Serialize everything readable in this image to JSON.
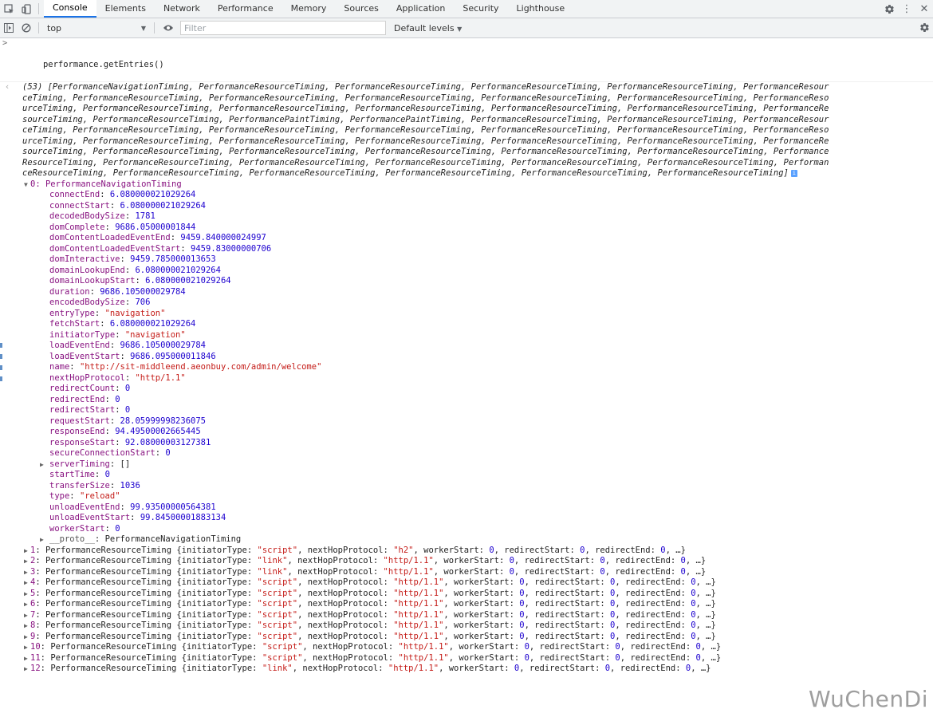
{
  "tabs": {
    "items": [
      "Console",
      "Elements",
      "Network",
      "Performance",
      "Memory",
      "Sources",
      "Application",
      "Security",
      "Lighthouse"
    ],
    "active": "Console"
  },
  "toolbar": {
    "context": "top",
    "filter_placeholder": "Filter",
    "levels": "Default levels"
  },
  "console": {
    "command": "performance.getEntries()",
    "array_lines": [
      "(53) [PerformanceNavigationTiming, PerformanceResourceTiming, PerformanceResourceTiming, PerformanceResourceTiming, PerformanceResourceTiming, PerformanceResour",
      "ceTiming, PerformanceResourceTiming, PerformanceResourceTiming, PerformanceResourceTiming, PerformanceResourceTiming, PerformanceResourceTiming, PerformanceReso",
      "urceTiming, PerformanceResourceTiming, PerformanceResourceTiming, PerformanceResourceTiming, PerformanceResourceTiming, PerformanceResourceTiming, PerformanceRe",
      "sourceTiming, PerformanceResourceTiming, PerformancePaintTiming, PerformancePaintTiming, PerformanceResourceTiming, PerformanceResourceTiming, PerformanceResour",
      "ceTiming, PerformanceResourceTiming, PerformanceResourceTiming, PerformanceResourceTiming, PerformanceResourceTiming, PerformanceResourceTiming, PerformanceReso",
      "urceTiming, PerformanceResourceTiming, PerformanceResourceTiming, PerformanceResourceTiming, PerformanceResourceTiming, PerformanceResourceTiming, PerformanceRe",
      "sourceTiming, PerformanceResourceTiming, PerformanceResourceTiming, PerformanceResourceTiming, PerformanceResourceTiming, PerformanceResourceTiming, Performance",
      "ResourceTiming, PerformanceResourceTiming, PerformanceResourceTiming, PerformanceResourceTiming, PerformanceResourceTiming, PerformanceResourceTiming, Performan",
      "ceResourceTiming, PerformanceResourceTiming, PerformanceResourceTiming, PerformanceResourceTiming, PerformanceResourceTiming, PerformanceResourceTiming]"
    ],
    "entry0_head": "0: PerformanceNavigationTiming",
    "entry0_props": [
      {
        "key": "connectEnd",
        "value": "6.080000021029264",
        "type": "num"
      },
      {
        "key": "connectStart",
        "value": "6.080000021029264",
        "type": "num"
      },
      {
        "key": "decodedBodySize",
        "value": "1781",
        "type": "num"
      },
      {
        "key": "domComplete",
        "value": "9686.05000001844",
        "type": "num"
      },
      {
        "key": "domContentLoadedEventEnd",
        "value": "9459.840000024997",
        "type": "num"
      },
      {
        "key": "domContentLoadedEventStart",
        "value": "9459.83000000706",
        "type": "num"
      },
      {
        "key": "domInteractive",
        "value": "9459.785000013653",
        "type": "num"
      },
      {
        "key": "domainLookupEnd",
        "value": "6.080000021029264",
        "type": "num"
      },
      {
        "key": "domainLookupStart",
        "value": "6.080000021029264",
        "type": "num"
      },
      {
        "key": "duration",
        "value": "9686.105000029784",
        "type": "num"
      },
      {
        "key": "encodedBodySize",
        "value": "706",
        "type": "num"
      },
      {
        "key": "entryType",
        "value": "\"navigation\"",
        "type": "str"
      },
      {
        "key": "fetchStart",
        "value": "6.080000021029264",
        "type": "num"
      },
      {
        "key": "initiatorType",
        "value": "\"navigation\"",
        "type": "str"
      },
      {
        "key": "loadEventEnd",
        "value": "9686.105000029784",
        "type": "num"
      },
      {
        "key": "loadEventStart",
        "value": "9686.095000011846",
        "type": "num"
      },
      {
        "key": "name",
        "value": "\"http://sit-middleend.aeonbuy.com/admin/welcome\"",
        "type": "str"
      },
      {
        "key": "nextHopProtocol",
        "value": "\"http/1.1\"",
        "type": "str"
      },
      {
        "key": "redirectCount",
        "value": "0",
        "type": "num"
      },
      {
        "key": "redirectEnd",
        "value": "0",
        "type": "num"
      },
      {
        "key": "redirectStart",
        "value": "0",
        "type": "num"
      },
      {
        "key": "requestStart",
        "value": "28.05999998236075",
        "type": "num"
      },
      {
        "key": "responseEnd",
        "value": "94.49500002665445",
        "type": "num"
      },
      {
        "key": "responseStart",
        "value": "92.08000003127381",
        "type": "num"
      },
      {
        "key": "secureConnectionStart",
        "value": "0",
        "type": "num"
      },
      {
        "key": "serverTiming",
        "value": "[]",
        "type": "plain",
        "expandable": true
      },
      {
        "key": "startTime",
        "value": "0",
        "type": "num"
      },
      {
        "key": "transferSize",
        "value": "1036",
        "type": "num"
      },
      {
        "key": "type",
        "value": "\"reload\"",
        "type": "str"
      },
      {
        "key": "unloadEventEnd",
        "value": "99.93500000564381",
        "type": "num"
      },
      {
        "key": "unloadEventStart",
        "value": "99.84500001883134",
        "type": "num"
      },
      {
        "key": "workerStart",
        "value": "0",
        "type": "num"
      },
      {
        "key": "__proto__",
        "value": "PerformanceNavigationTiming",
        "type": "plain",
        "expandable": true
      }
    ],
    "resource_entries": [
      {
        "index": "1",
        "initiatorType": "\"script\"",
        "nextHopProtocol": "\"h2\""
      },
      {
        "index": "2",
        "initiatorType": "\"link\"",
        "nextHopProtocol": "\"http/1.1\""
      },
      {
        "index": "3",
        "initiatorType": "\"link\"",
        "nextHopProtocol": "\"http/1.1\""
      },
      {
        "index": "4",
        "initiatorType": "\"script\"",
        "nextHopProtocol": "\"http/1.1\""
      },
      {
        "index": "5",
        "initiatorType": "\"script\"",
        "nextHopProtocol": "\"http/1.1\""
      },
      {
        "index": "6",
        "initiatorType": "\"script\"",
        "nextHopProtocol": "\"http/1.1\""
      },
      {
        "index": "7",
        "initiatorType": "\"script\"",
        "nextHopProtocol": "\"http/1.1\""
      },
      {
        "index": "8",
        "initiatorType": "\"script\"",
        "nextHopProtocol": "\"http/1.1\""
      },
      {
        "index": "9",
        "initiatorType": "\"script\"",
        "nextHopProtocol": "\"http/1.1\""
      },
      {
        "index": "10",
        "initiatorType": "\"script\"",
        "nextHopProtocol": "\"http/1.1\""
      },
      {
        "index": "11",
        "initiatorType": "\"script\"",
        "nextHopProtocol": "\"http/1.1\""
      },
      {
        "index": "12",
        "initiatorType": "\"link\"",
        "nextHopProtocol": "\"http/1.1\""
      }
    ],
    "resource_type_name": "PerformanceResourceTiming",
    "resource_tail": {
      "workerStart": "0",
      "redirectStart": "0",
      "redirectEnd": "0",
      "ellipsis": "…}"
    }
  },
  "watermark": "WuChenDi"
}
